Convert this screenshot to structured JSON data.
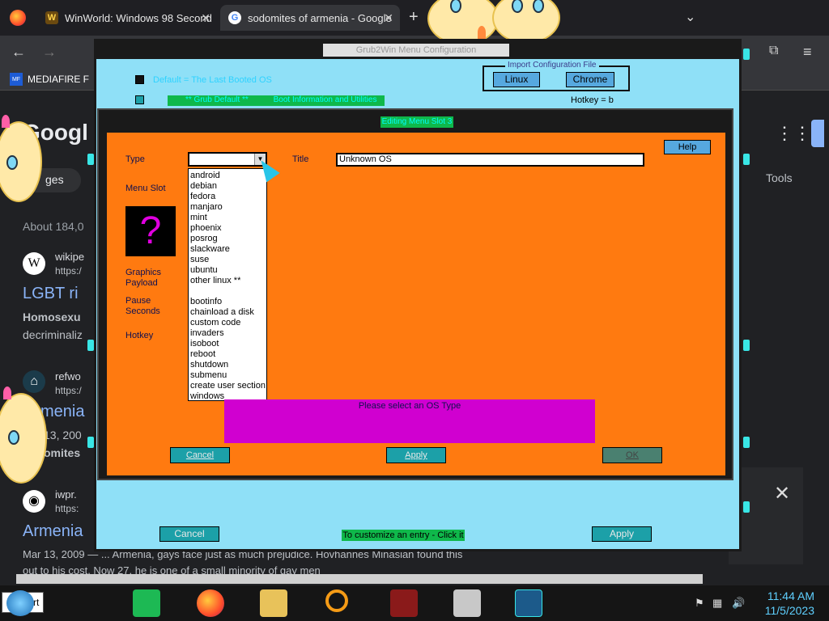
{
  "browser": {
    "tabs": [
      {
        "title": "WinWorld: Windows 98 Second",
        "favicon": "winworld-icon"
      },
      {
        "title": "sodomites of armenia - Google",
        "favicon": "google-icon",
        "active": true
      }
    ],
    "bookmark": "MEDIAFIRE F"
  },
  "google": {
    "logo": "Googl",
    "images_pill": "ges",
    "tools": "Tools",
    "about": "About 184,0",
    "results": [
      {
        "site": "wikipe",
        "url": "https:/",
        "title": "LGBT ri",
        "snippet1": "Homosexu",
        "snippet2": "decriminaliz"
      },
      {
        "site": "refwo",
        "url": "https:/",
        "title": "menia",
        "snippet1": "13, 200",
        "snippet2": "omites"
      },
      {
        "site": "iwpr.",
        "url": "https:",
        "title": "Armenia",
        "snippet1": "Mar 13, 2009 — ... Armenia, gays face just as much prejudice. Hovhannes Minasian found this",
        "snippet2": "out to his cost. Now 27, he is one of a small minority of gay men"
      }
    ]
  },
  "grub_main": {
    "title": "Grub2Win Menu Configuration",
    "default_entry": "Default = The Last Booted OS",
    "grub_default": "** Grub Default **",
    "boot_info": "Boot Information and Utilities",
    "hotkey": "Hotkey = b",
    "import_label": "Import Configuration File",
    "linux_btn": "Linux",
    "chrome_btn": "Chrome",
    "cancel_btn": "Cancel",
    "customize_text": "To customize an entry - Click it",
    "apply_btn": "Apply"
  },
  "dialog": {
    "title": "Editing Menu Slot 3",
    "labels": {
      "type": "Type",
      "menu_slot": "Menu Slot",
      "graphics_payload": "Graphics\nPayload",
      "pause_seconds": "Pause\nSeconds",
      "hotkey": "Hotkey",
      "title": "Title"
    },
    "title_value": "Unknown OS",
    "help_btn": "Help",
    "question_mark": "?",
    "type_options_a": [
      "android",
      "debian",
      "fedora",
      "manjaro",
      "mint",
      "phoenix",
      "posrog",
      "slackware",
      "suse",
      "ubuntu",
      "other linux **"
    ],
    "type_options_b": [
      "bootinfo",
      "chainload a disk",
      "custom code",
      "invaders",
      "isoboot",
      "reboot",
      "shutdown",
      "submenu",
      "create user section",
      "windows"
    ],
    "message": "Please select an OS Type",
    "cancel_btn": "Cancel",
    "apply_btn": "Apply",
    "ok_btn": "OK"
  },
  "taskbar": {
    "search_text": "rt",
    "time": "11:44 AM",
    "date": "11/5/2023"
  },
  "colors": {
    "dialog_bg": "#ff7a10",
    "grub_bg": "#8fe0f7",
    "accent_green": "#0fb84b",
    "message_bg": "#d000d0"
  }
}
